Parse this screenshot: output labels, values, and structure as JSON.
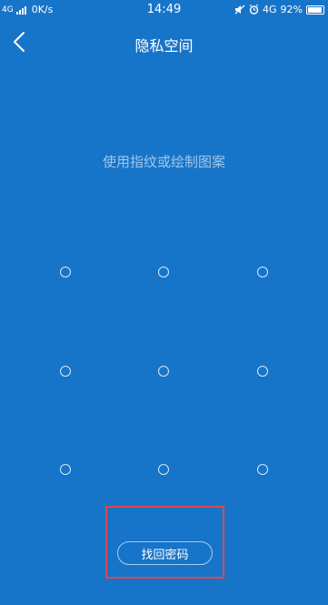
{
  "status_bar": {
    "network_left": "4G",
    "speed": "0K/s",
    "time": "14:49",
    "network_right": "4G",
    "battery_percent": "92%",
    "battery_level": 0.92
  },
  "nav": {
    "back_icon": "chevron-left-icon",
    "title": "隐私空间"
  },
  "hint": "使用指纹或绘制图案",
  "pattern": {
    "rows": 3,
    "cols": 3
  },
  "recover_button_label": "找回密码",
  "colors": {
    "background": "#1775c9",
    "hint_text": "#9fc6ea",
    "highlight_border": "#e0474b"
  }
}
